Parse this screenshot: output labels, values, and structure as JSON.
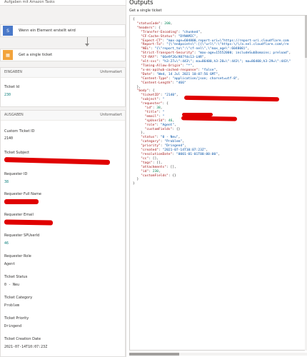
{
  "flow": {
    "top_text": "Aufgaben mit Amazon Tasks",
    "trigger_label": "Wenn ein Element erstellt wird",
    "action_label": "Get a single ticket"
  },
  "inputs": {
    "header": "EINGABEN",
    "right_text": "Unformatiert",
    "ticket_id_label": "Ticket Id",
    "ticket_id_value": "230"
  },
  "outputs_section": {
    "header": "AUSGABEN",
    "right_text": "Unformatiert",
    "fields": [
      {
        "label": "Custom Ticket ID",
        "value": "2140"
      },
      {
        "label": "Ticket Subject",
        "value": ""
      },
      {
        "label": "Requester ID",
        "value": "38"
      },
      {
        "label": "Requester Full Name",
        "value": ""
      },
      {
        "label": "Requester Email",
        "value": ""
      },
      {
        "label": "Requester SPUserId",
        "value": "46"
      },
      {
        "label": "Requester Role",
        "value": "Agent"
      },
      {
        "label": "Ticket Status",
        "value": "0 - Neu"
      },
      {
        "label": "Ticket Category",
        "value": "Problem"
      },
      {
        "label": "Ticket Priority",
        "value": "Dringend"
      },
      {
        "label": "Ticket Creation Date",
        "value": "2021-07-14T10:07:23Z"
      }
    ]
  },
  "panel": {
    "title": "Outputs",
    "subtitle": "Get a single ticket"
  },
  "json_lines": [
    "{",
    "  \"statusCode\": 200,",
    "  \"headers\": {",
    "    \"Transfer-Encoding\": \"chunked\",",
    "    \"CF-Cache-Status\": \"DYNAMIC\",",
    "    \"Expect-CT\": \"max-age=604800,report-uri=\\\"https://report-uri.cloudflare.com",
    "    \"Report-To\": \"{\\\"endpoints\\\":[{\\\"url\\\":\\\"https:\\/\\/a.nel.cloudflare.com\\/re",
    "    \"NEL\": \"{\\\"report_to\\\":\\\"cf-nel\\\",\\\"max_age\\\":604800}\",",
    "    \"Strict-Transport-Security\": \"max-age=15552000; includeSubDomains; preload\",",
    "    \"CF-RAY\": \"66e9f26c987fdc13-LHR\",",
    "    \"alt-svc\": \"h3-27=\\\":443\\\"; ma=86400,h3-28=\\\":443\\\"; ma=86400,h3-29=\\\":443\\\"",
    "    \"Timing-Allow-Origin\": \"*\",",
    "    \"x-ms-apihub-cached-response\": \"false\",",
    "    \"Date\": \"Wed, 14 Jul 2021 10:07:56 GMT\",",
    "    \"Content-Type\": \"application/json; charset=utf-8\",",
    "    \"Content-Length\": \"466\"",
    "  },",
    "  \"body\": {",
    "    \"ticketID\": \"2140\",",
    "    \"subject\": \"",
    "    \"requester\": {",
    "      \"id\": 38,",
    "      \"title\": \"",
    "      \"email\": \"",
    "      \"spUserId\": 46,",
    "      \"role\": \"Agent\",",
    "      \"customFields\": {}",
    "    },",
    "    \"status\": \"0 - Neu\",",
    "    \"category\": \"Problem\",",
    "    \"priority\": \"Dringend\",",
    "    \"created\": \"2021-07-14T10:07:23Z\",",
    "    \"resolutionDate\": \"0001-01-01T00:00:00\",",
    "    \"cc\": [],",
    "    \"tags\": [],",
    "    \"attachments\": [],",
    "    \"id\": 230,",
    "    \"customFields\": {}",
    "  }",
    "}"
  ]
}
